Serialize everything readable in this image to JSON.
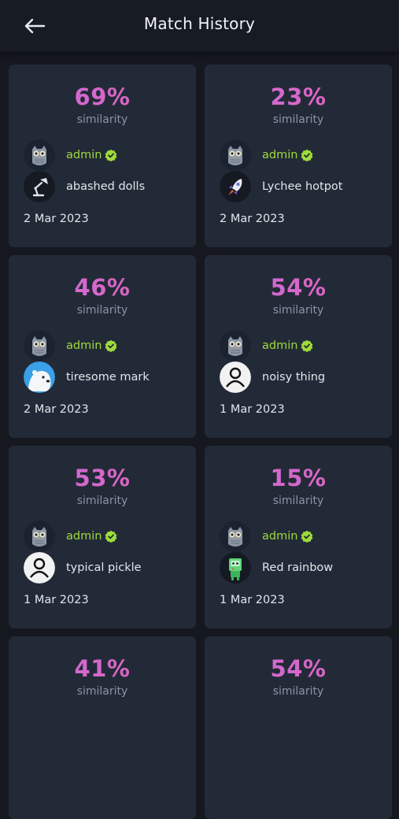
{
  "header": {
    "title": "Match History"
  },
  "similarity_label": "similarity",
  "admin_name": "admin",
  "colors": {
    "background": "#15181f",
    "card": "#232a37",
    "percent_gradient_start": "#c86fe0",
    "percent_gradient_end": "#e35fb4",
    "admin": "#9edb3b",
    "muted": "#8b93a6"
  },
  "matches": [
    {
      "percent": "69%",
      "user": "abashed dolls",
      "avatar": "lamp-icon",
      "date": "2 Mar 2023"
    },
    {
      "percent": "23%",
      "user": "Lychee hotpot",
      "avatar": "rocket-icon",
      "date": "2 Mar 2023"
    },
    {
      "percent": "46%",
      "user": "tiresome mark",
      "avatar": "polar-bear-icon",
      "date": "2 Mar 2023"
    },
    {
      "percent": "54%",
      "user": "noisy thing",
      "avatar": "default-user-icon",
      "date": "1 Mar 2023"
    },
    {
      "percent": "53%",
      "user": "typical pickle",
      "avatar": "default-user-icon",
      "date": "1 Mar 2023"
    },
    {
      "percent": "15%",
      "user": "Red rainbow",
      "avatar": "robot-icon",
      "date": "1 Mar 2023"
    },
    {
      "percent": "41%"
    },
    {
      "percent": "54%"
    }
  ]
}
